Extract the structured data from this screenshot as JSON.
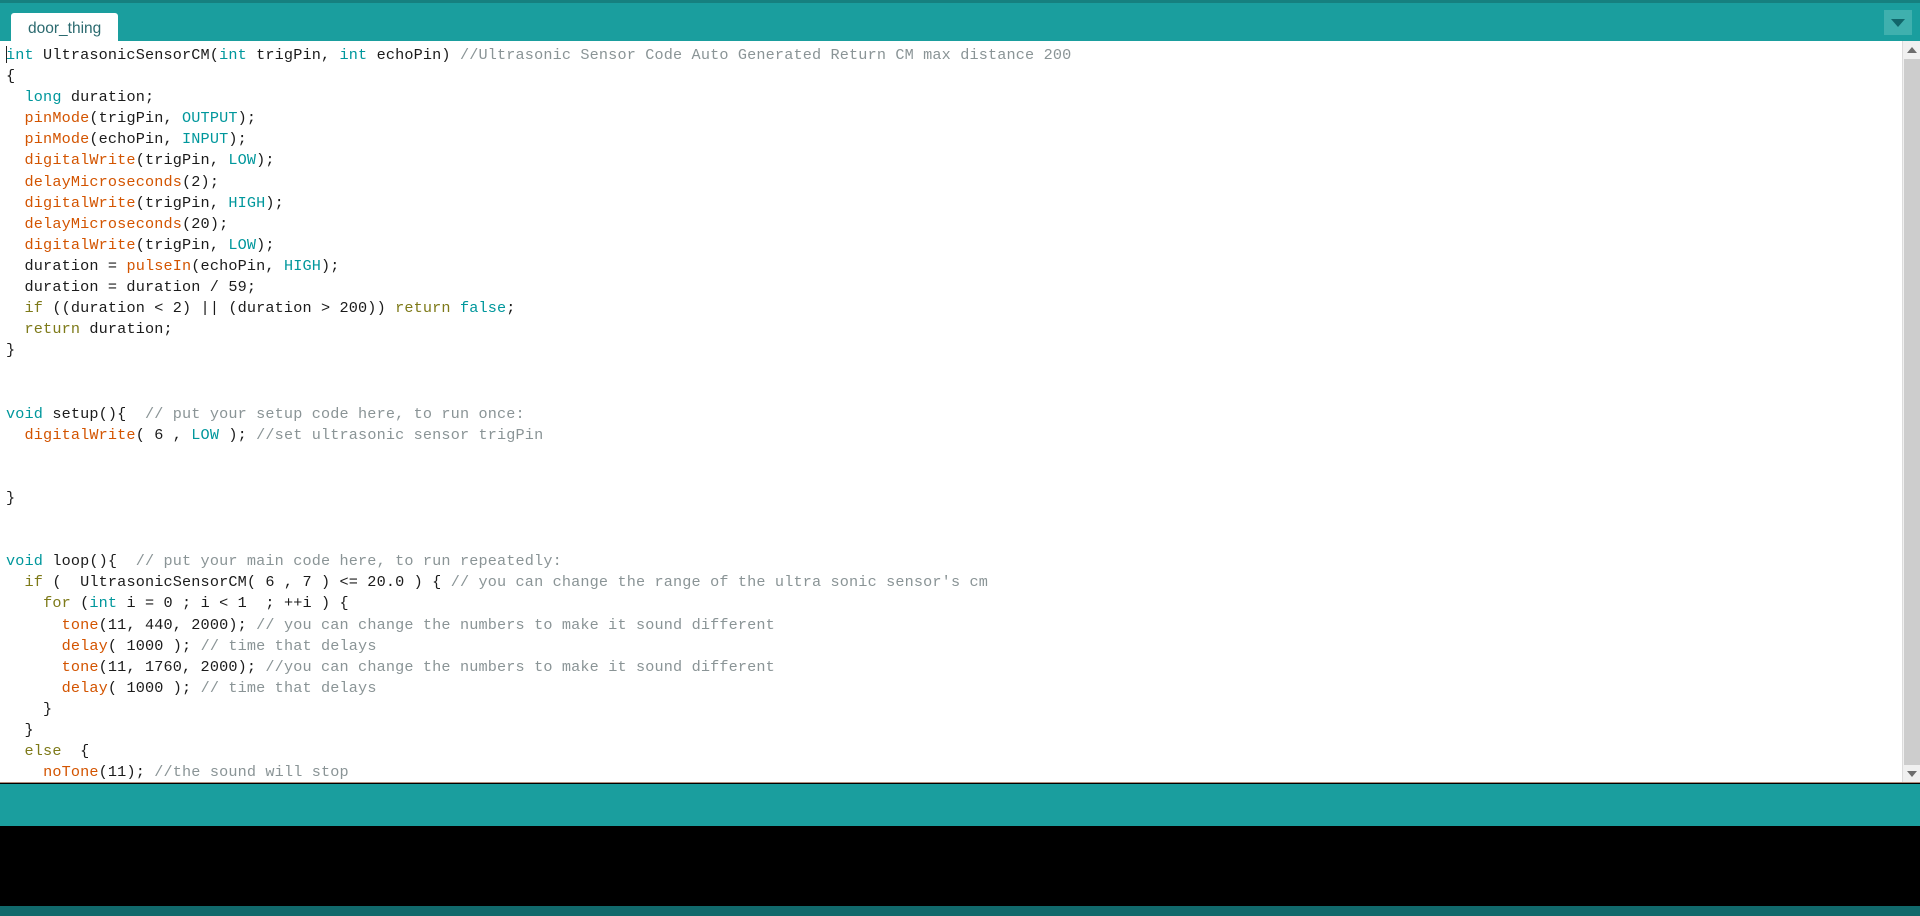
{
  "window": {
    "app": "Arduino IDE",
    "accent_teal": "#1a9e9e",
    "accent_teal_dark": "#11696b",
    "editor_bg": "#ffffff"
  },
  "tabbar": {
    "tab_label": "door_thing",
    "menu_icon": "chevron-down-icon"
  },
  "scrollbar": {
    "up_icon": "chevron-up-icon",
    "down_icon": "chevron-down-icon"
  },
  "editor": {
    "language": "arduino-cpp",
    "cursor_line": 1,
    "cursor_column": 1,
    "colors": {
      "keyword": "#00979c",
      "function": "#d35400",
      "control": "#7e7a19",
      "comment": "#8a9496",
      "text": "#1b1b1b"
    },
    "code": "int UltrasonicSensorCM(int trigPin, int echoPin) //Ultrasonic Sensor Code Auto Generated Return CM max distance 200\n{\n  long duration;\n  pinMode(trigPin, OUTPUT);\n  pinMode(echoPin, INPUT);\n  digitalWrite(trigPin, LOW);\n  delayMicroseconds(2);\n  digitalWrite(trigPin, HIGH);\n  delayMicroseconds(20);\n  digitalWrite(trigPin, LOW);\n  duration = pulseIn(echoPin, HIGH);\n  duration = duration / 59;\n  if ((duration < 2) || (duration > 200)) return false;\n  return duration;\n}\n\n\nvoid setup(){  // put your setup code here, to run once:\n  digitalWrite( 6 , LOW ); //set ultrasonic sensor trigPin\n\n\n}\n\n\nvoid loop(){  // put your main code here, to run repeatedly:\n  if (  UltrasonicSensorCM( 6 , 7 ) <= 20.0 ) { // you can change the range of the ultra sonic sensor's cm\n    for (int i = 0 ; i < 1  ; ++i ) {\n      tone(11, 440, 2000); // you can change the numbers to make it sound different\n      delay( 1000 ); // time that delays\n      tone(11, 1760, 2000); //you can change the numbers to make it sound different\n      delay( 1000 ); // time that delays\n    }\n  }\n  else  {\n    noTone(11); //the sound will stop\n  }\n}",
    "lines": [
      {
        "i": 1,
        "tokens": [
          {
            "t": "kw",
            "s": "int"
          },
          {
            "t": "txt",
            "s": " UltrasonicSensorCM("
          },
          {
            "t": "kw",
            "s": "int"
          },
          {
            "t": "txt",
            "s": " trigPin, "
          },
          {
            "t": "kw",
            "s": "int"
          },
          {
            "t": "txt",
            "s": " echoPin) "
          },
          {
            "t": "cmt",
            "s": "//Ultrasonic Sensor Code Auto Generated Return CM max distance 200"
          }
        ]
      },
      {
        "i": 2,
        "tokens": [
          {
            "t": "txt",
            "s": "{"
          }
        ]
      },
      {
        "i": 3,
        "tokens": [
          {
            "t": "txt",
            "s": "  "
          },
          {
            "t": "kw",
            "s": "long"
          },
          {
            "t": "txt",
            "s": " duration;"
          }
        ]
      },
      {
        "i": 4,
        "tokens": [
          {
            "t": "txt",
            "s": "  "
          },
          {
            "t": "fn",
            "s": "pinMode"
          },
          {
            "t": "txt",
            "s": "(trigPin, "
          },
          {
            "t": "kw",
            "s": "OUTPUT"
          },
          {
            "t": "txt",
            "s": ");"
          }
        ]
      },
      {
        "i": 5,
        "tokens": [
          {
            "t": "txt",
            "s": "  "
          },
          {
            "t": "fn",
            "s": "pinMode"
          },
          {
            "t": "txt",
            "s": "(echoPin, "
          },
          {
            "t": "kw",
            "s": "INPUT"
          },
          {
            "t": "txt",
            "s": ");"
          }
        ]
      },
      {
        "i": 6,
        "tokens": [
          {
            "t": "txt",
            "s": "  "
          },
          {
            "t": "fn",
            "s": "digitalWrite"
          },
          {
            "t": "txt",
            "s": "(trigPin, "
          },
          {
            "t": "kw",
            "s": "LOW"
          },
          {
            "t": "txt",
            "s": ");"
          }
        ]
      },
      {
        "i": 7,
        "tokens": [
          {
            "t": "txt",
            "s": "  "
          },
          {
            "t": "fn",
            "s": "delayMicroseconds"
          },
          {
            "t": "txt",
            "s": "(2);"
          }
        ]
      },
      {
        "i": 8,
        "tokens": [
          {
            "t": "txt",
            "s": "  "
          },
          {
            "t": "fn",
            "s": "digitalWrite"
          },
          {
            "t": "txt",
            "s": "(trigPin, "
          },
          {
            "t": "kw",
            "s": "HIGH"
          },
          {
            "t": "txt",
            "s": ");"
          }
        ]
      },
      {
        "i": 9,
        "tokens": [
          {
            "t": "txt",
            "s": "  "
          },
          {
            "t": "fn",
            "s": "delayMicroseconds"
          },
          {
            "t": "txt",
            "s": "(20);"
          }
        ]
      },
      {
        "i": 10,
        "tokens": [
          {
            "t": "txt",
            "s": "  "
          },
          {
            "t": "fn",
            "s": "digitalWrite"
          },
          {
            "t": "txt",
            "s": "(trigPin, "
          },
          {
            "t": "kw",
            "s": "LOW"
          },
          {
            "t": "txt",
            "s": ");"
          }
        ]
      },
      {
        "i": 11,
        "tokens": [
          {
            "t": "txt",
            "s": "  duration = "
          },
          {
            "t": "fn",
            "s": "pulseIn"
          },
          {
            "t": "txt",
            "s": "(echoPin, "
          },
          {
            "t": "kw",
            "s": "HIGH"
          },
          {
            "t": "txt",
            "s": ");"
          }
        ]
      },
      {
        "i": 12,
        "tokens": [
          {
            "t": "txt",
            "s": "  duration = duration / 59;"
          }
        ]
      },
      {
        "i": 13,
        "tokens": [
          {
            "t": "txt",
            "s": "  "
          },
          {
            "t": "ctrl",
            "s": "if"
          },
          {
            "t": "txt",
            "s": " ((duration < 2) || (duration > 200)) "
          },
          {
            "t": "ctrl",
            "s": "return"
          },
          {
            "t": "txt",
            "s": " "
          },
          {
            "t": "kw",
            "s": "false"
          },
          {
            "t": "txt",
            "s": ";"
          }
        ]
      },
      {
        "i": 14,
        "tokens": [
          {
            "t": "txt",
            "s": "  "
          },
          {
            "t": "ctrl",
            "s": "return"
          },
          {
            "t": "txt",
            "s": " duration;"
          }
        ]
      },
      {
        "i": 15,
        "tokens": [
          {
            "t": "txt",
            "s": "}"
          }
        ]
      },
      {
        "i": 16,
        "tokens": []
      },
      {
        "i": 17,
        "tokens": []
      },
      {
        "i": 18,
        "tokens": [
          {
            "t": "kw",
            "s": "void"
          },
          {
            "t": "txt",
            "s": " setup(){  "
          },
          {
            "t": "cmt",
            "s": "// put your setup code here, to run once:"
          }
        ]
      },
      {
        "i": 19,
        "tokens": [
          {
            "t": "txt",
            "s": "  "
          },
          {
            "t": "fn",
            "s": "digitalWrite"
          },
          {
            "t": "txt",
            "s": "( 6 , "
          },
          {
            "t": "kw",
            "s": "LOW"
          },
          {
            "t": "txt",
            "s": " ); "
          },
          {
            "t": "cmt",
            "s": "//set ultrasonic sensor trigPin"
          }
        ]
      },
      {
        "i": 20,
        "tokens": []
      },
      {
        "i": 21,
        "tokens": []
      },
      {
        "i": 22,
        "tokens": [
          {
            "t": "txt",
            "s": "}"
          }
        ]
      },
      {
        "i": 23,
        "tokens": []
      },
      {
        "i": 24,
        "tokens": []
      },
      {
        "i": 25,
        "tokens": [
          {
            "t": "kw",
            "s": "void"
          },
          {
            "t": "txt",
            "s": " loop(){  "
          },
          {
            "t": "cmt",
            "s": "// put your main code here, to run repeatedly:"
          }
        ]
      },
      {
        "i": 26,
        "tokens": [
          {
            "t": "txt",
            "s": "  "
          },
          {
            "t": "ctrl",
            "s": "if"
          },
          {
            "t": "txt",
            "s": " (  UltrasonicSensorCM( 6 , 7 ) <= 20.0 ) { "
          },
          {
            "t": "cmt",
            "s": "// you can change the range of the ultra sonic sensor's cm"
          }
        ]
      },
      {
        "i": 27,
        "tokens": [
          {
            "t": "txt",
            "s": "    "
          },
          {
            "t": "ctrl",
            "s": "for"
          },
          {
            "t": "txt",
            "s": " ("
          },
          {
            "t": "kw",
            "s": "int"
          },
          {
            "t": "txt",
            "s": " i = 0 ; i < 1  ; ++i ) {"
          }
        ]
      },
      {
        "i": 28,
        "tokens": [
          {
            "t": "txt",
            "s": "      "
          },
          {
            "t": "fn",
            "s": "tone"
          },
          {
            "t": "txt",
            "s": "(11, 440, 2000); "
          },
          {
            "t": "cmt",
            "s": "// you can change the numbers to make it sound different"
          }
        ]
      },
      {
        "i": 29,
        "tokens": [
          {
            "t": "txt",
            "s": "      "
          },
          {
            "t": "fn",
            "s": "delay"
          },
          {
            "t": "txt",
            "s": "( 1000 ); "
          },
          {
            "t": "cmt",
            "s": "// time that delays"
          }
        ]
      },
      {
        "i": 30,
        "tokens": [
          {
            "t": "txt",
            "s": "      "
          },
          {
            "t": "fn",
            "s": "tone"
          },
          {
            "t": "txt",
            "s": "(11, 1760, 2000); "
          },
          {
            "t": "cmt",
            "s": "//you can change the numbers to make it sound different"
          }
        ]
      },
      {
        "i": 31,
        "tokens": [
          {
            "t": "txt",
            "s": "      "
          },
          {
            "t": "fn",
            "s": "delay"
          },
          {
            "t": "txt",
            "s": "( 1000 ); "
          },
          {
            "t": "cmt",
            "s": "// time that delays"
          }
        ]
      },
      {
        "i": 32,
        "tokens": [
          {
            "t": "txt",
            "s": "    }"
          }
        ]
      },
      {
        "i": 33,
        "tokens": [
          {
            "t": "txt",
            "s": "  }"
          }
        ]
      },
      {
        "i": 34,
        "tokens": [
          {
            "t": "txt",
            "s": "  "
          },
          {
            "t": "ctrl",
            "s": "else"
          },
          {
            "t": "txt",
            "s": "  {"
          }
        ]
      },
      {
        "i": 35,
        "tokens": [
          {
            "t": "txt",
            "s": "    "
          },
          {
            "t": "fn",
            "s": "noTone"
          },
          {
            "t": "txt",
            "s": "(11); "
          },
          {
            "t": "cmt",
            "s": "//the sound will stop"
          }
        ]
      },
      {
        "i": 36,
        "tokens": [
          {
            "t": "txt",
            "s": "  }"
          }
        ]
      },
      {
        "i": 37,
        "tokens": [
          {
            "t": "txt",
            "s": "}"
          }
        ]
      }
    ]
  },
  "status_band": {
    "text": ""
  },
  "console": {
    "text": ""
  }
}
